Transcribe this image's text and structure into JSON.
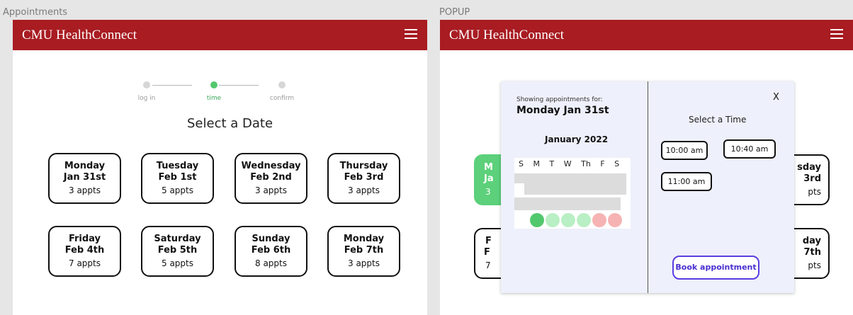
{
  "left_frame": {
    "label": "Appointments",
    "app_title": "CMU HealthConnect",
    "steps": [
      {
        "label": "log in",
        "active": false
      },
      {
        "label": "time",
        "active": true
      },
      {
        "label": "confirm",
        "active": false
      }
    ],
    "heading": "Select a Date",
    "cards": [
      {
        "day": "Monday",
        "date": "Jan 31st",
        "appts": "3 appts"
      },
      {
        "day": "Tuesday",
        "date": "Feb 1st",
        "appts": "5 appts"
      },
      {
        "day": "Wednesday",
        "date": "Feb 2nd",
        "appts": "3 appts"
      },
      {
        "day": "Thursday",
        "date": "Feb 3rd",
        "appts": "3 appts"
      },
      {
        "day": "Friday",
        "date": "Feb 4th",
        "appts": "7 appts"
      },
      {
        "day": "Saturday",
        "date": "Feb 5th",
        "appts": "5 appts"
      },
      {
        "day": "Sunday",
        "date": "Feb 6th",
        "appts": "8 appts"
      },
      {
        "day": "Monday",
        "date": "Feb 7th",
        "appts": "3 appts"
      }
    ]
  },
  "right_frame": {
    "label": "POPUP",
    "app_title": "CMU HealthConnect",
    "partial_cards": [
      {
        "left_text": "M",
        "left_text2": "Ja",
        "left_text3": "3",
        "selected": true
      },
      {
        "left_text": "F",
        "left_text2": "F",
        "left_text3": "7",
        "selected": false
      }
    ],
    "partial_cards_right": [
      {
        "line1": "sday",
        "line2": "3rd",
        "line3": "pts"
      },
      {
        "line1": "day",
        "line2": "7th",
        "line3": "pts"
      }
    ],
    "popup": {
      "showing_label": "Showing appointments for:",
      "selected_day": "Monday Jan 31st",
      "month": "January 2022",
      "weekdays": [
        "S",
        "M",
        "T",
        "W",
        "Th",
        "F",
        "S"
      ],
      "availability_colors": [
        "#52c86e",
        "#b9efc4",
        "#b9efc4",
        "#b9efc4",
        "#f6b3b3",
        "#f6b3b3"
      ],
      "close_label": "X",
      "time_heading": "Select a Time",
      "times": [
        "10:00 am",
        "10:40 am",
        "11:00 am"
      ],
      "book_label": "Book appointment"
    }
  }
}
